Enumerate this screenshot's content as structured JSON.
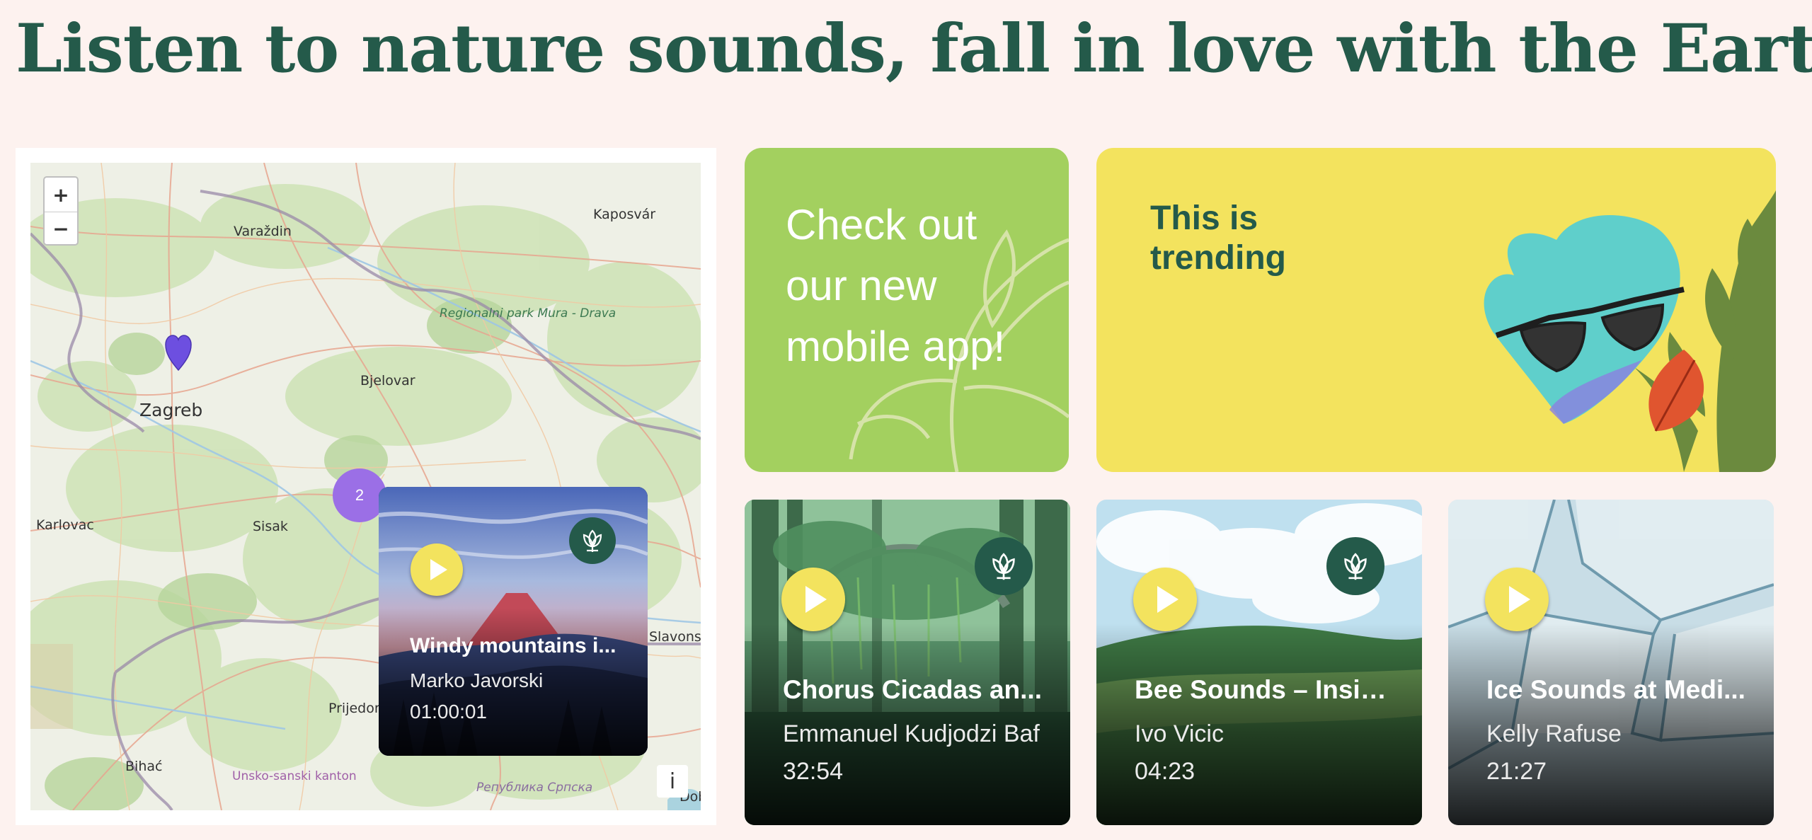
{
  "page": {
    "title": "Listen to nature sounds, fall in love with the Earth"
  },
  "map": {
    "zoom_in": "+",
    "zoom_out": "−",
    "info": "i",
    "cluster_count": "2",
    "labels": {
      "varazdin": "Varaždin",
      "kaposvar": "Kaposvár",
      "park": "Regionalni park Mura - Drava",
      "bjelovar": "Bjelovar",
      "zagreb": "Zagreb",
      "karlovac": "Karlovac",
      "sisak": "Sisak",
      "slavonski": "Slavonski Brod",
      "prijedor": "Prijedor",
      "bihac": "Bihać",
      "unsko": "Unsko-sanski kanton",
      "republika": "Република Српска",
      "dob": "Dob"
    },
    "popup": {
      "title": "Windy mountains i...",
      "author": "Marko Javorski",
      "duration": "01:00:01"
    }
  },
  "promos": {
    "app": "Check out our new mobile app!",
    "trending": "This is trending"
  },
  "cards": [
    {
      "title": "Chorus Cicadas an...",
      "author": "Emmanuel Kudjodzi Baf",
      "duration": "32:54",
      "badge": true
    },
    {
      "title": "Bee Sounds – Insid...",
      "author": "Ivo Vicic",
      "duration": "04:23",
      "badge": true
    },
    {
      "title": "Ice Sounds at Medi...",
      "author": "Kelly Rafuse",
      "duration": "21:27",
      "badge": false
    }
  ],
  "colors": {
    "background": "#fdf2ef",
    "brand_green": "#245a4a",
    "app_green": "#a3d05f",
    "trend_yellow": "#f3e35e",
    "cluster_purple": "#9b6fe6"
  },
  "icons": {
    "play": "play-icon",
    "badge": "lotus-icon",
    "pin": "heart-pin-icon"
  }
}
